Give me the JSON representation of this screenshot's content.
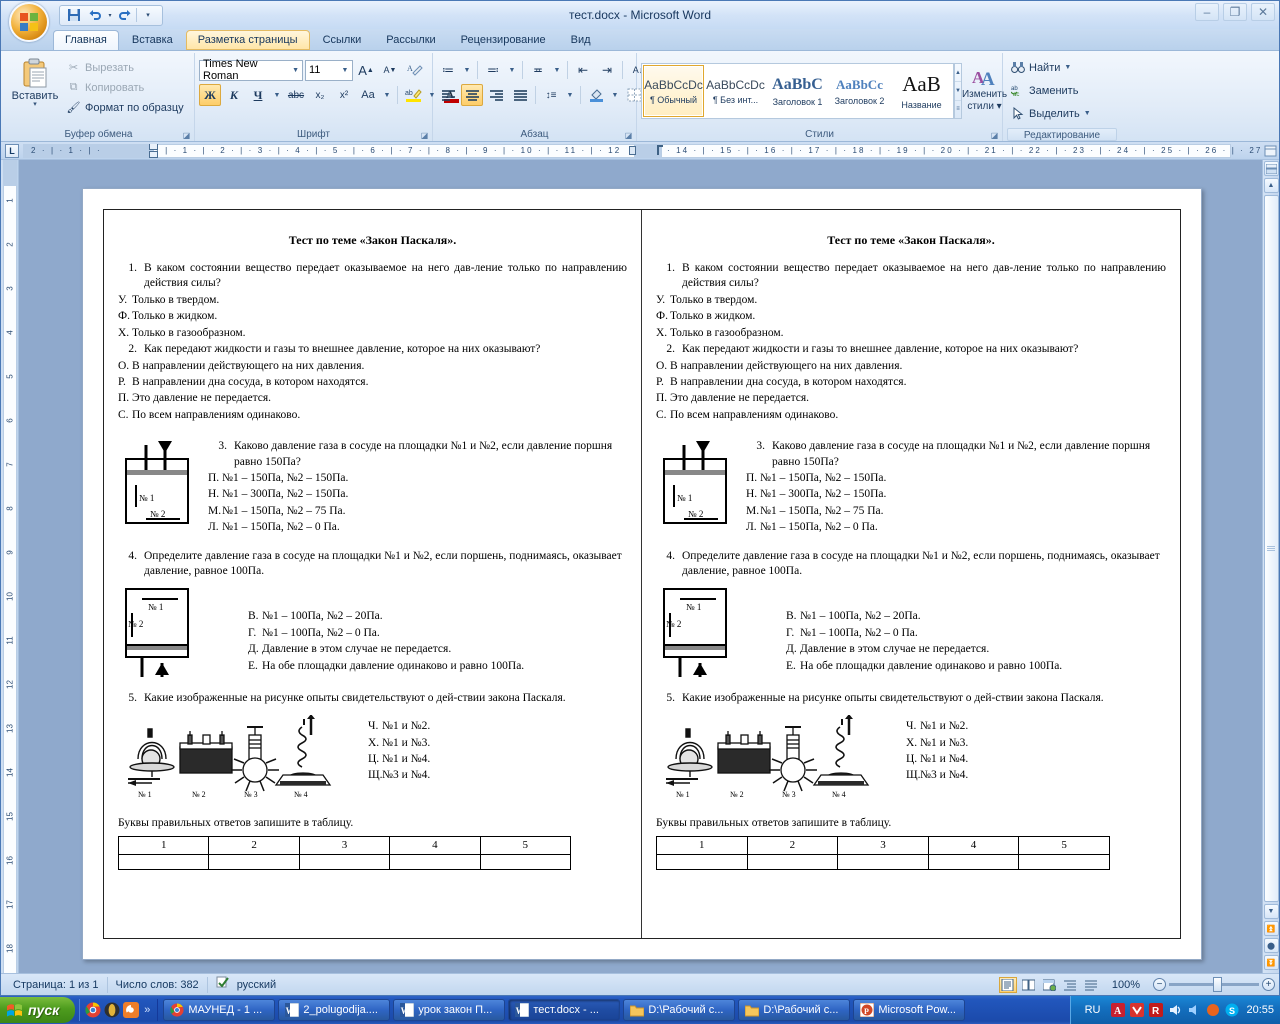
{
  "window": {
    "title": "тест.docx - Microsoft Word",
    "minimize": "–",
    "maximize": "❐",
    "close": "✕"
  },
  "quick_access": {
    "save": "💾",
    "undo": "↰",
    "redo": "↻",
    "customize": "▾"
  },
  "ribbon": {
    "tabs": [
      {
        "label": "Главная",
        "state": "active"
      },
      {
        "label": "Вставка",
        "state": "normal"
      },
      {
        "label": "Разметка страницы",
        "state": "hover"
      },
      {
        "label": "Ссылки",
        "state": "normal"
      },
      {
        "label": "Рассылки",
        "state": "normal"
      },
      {
        "label": "Рецензирование",
        "state": "normal"
      },
      {
        "label": "Вид",
        "state": "normal"
      }
    ],
    "clipboard": {
      "group_label": "Буфер обмена",
      "paste": "Вставить",
      "paste_arrow": "▾",
      "cut": "Вырезать",
      "copy": "Копировать",
      "format_painter": "Формат по образцу"
    },
    "font": {
      "group_label": "Шрифт",
      "font_name": "Times New Roman",
      "font_size": "11",
      "grow": "A",
      "shrink": "A",
      "clear_format": "A⃫",
      "bold": "Ж",
      "italic": "К",
      "underline": "Ч",
      "strike": "abc",
      "subscript": "x₂",
      "superscript": "x²",
      "change_case": "Aa",
      "highlight": "ab",
      "font_color": "A"
    },
    "paragraph": {
      "group_label": "Абзац",
      "bullets": "≔",
      "numbering": "≕",
      "multilevel": "≖",
      "decrease_indent": "⇤",
      "increase_indent": "⇥",
      "sort": "A↓",
      "show_marks": "¶",
      "align_left": "≡",
      "align_center": "≡",
      "align_right": "≡",
      "justify": "≡",
      "line_spacing": "↕≡",
      "shading": "◇",
      "borders": "⊞"
    },
    "styles": {
      "group_label": "Стили",
      "items": [
        {
          "preview": "AaBbCcDc",
          "name": "¶ Обычный",
          "selected": true
        },
        {
          "preview": "AaBbCcDc",
          "name": "¶ Без инт...",
          "selected": false
        },
        {
          "preview": "AaBbC",
          "name": "Заголовок 1",
          "selected": false
        },
        {
          "preview": "AaBbCc",
          "name": "Заголовок 2",
          "selected": false
        },
        {
          "preview": "AaB",
          "name": "Название",
          "selected": false
        }
      ],
      "change_styles": "Изменить",
      "change_styles2": "стили ▾"
    },
    "editing": {
      "group_label": "Редактирование",
      "find": "Найти",
      "replace": "Заменить",
      "select": "Выделить"
    }
  },
  "ruler": {
    "tab_selector": "L",
    "horizontal_ticks_left": "2 · | · 1 · | · ",
    "horizontal_ticks_mid": "· | · 1 · | · 2 · | · 3 · | · 4 · | · 5 · | · 6 · | · 7 · | · 8 · | · 9 · | · 10 · | · 11 · | · 12",
    "horizontal_ticks_right": "· 14 · | · 15 · | · 16 · | · 17 · | · 18 · | · 19 · | · 20 · | · 21 · | · 22 · | · 23 · | · 24 · | · 25 · | · 26 · | · 27 · |",
    "vertical_numbers": [
      "1",
      "2",
      "3",
      "4",
      "5",
      "6",
      "7",
      "8",
      "9",
      "10",
      "11",
      "12",
      "13",
      "14",
      "15",
      "16",
      "17",
      "18"
    ]
  },
  "document": {
    "title": "Тест по теме «Закон Паскаля».",
    "questions": [
      {
        "num": "1.",
        "text": "В каком состоянии вещество передает оказываемое на него дав-ление только по направлению действия силы?",
        "options": [
          {
            "letter": "У.",
            "text": "Только в твердом."
          },
          {
            "letter": "Ф.",
            "text": "Только в жидком."
          },
          {
            "letter": "Х.",
            "text": "Только в газообразном."
          }
        ]
      },
      {
        "num": "2.",
        "text": "Как передают жидкости и газы то внешнее давление, которое на них оказывают?",
        "options": [
          {
            "letter": "О.",
            "text": "В направлении действующего на них давления."
          },
          {
            "letter": "Р.",
            "text": "В направлении дна сосуда, в котором находятся."
          },
          {
            "letter": "П.",
            "text": "Это давление не передается."
          },
          {
            "letter": "С.",
            "text": "По всем направлениям одинаково."
          }
        ]
      },
      {
        "num": "3.",
        "text": "Каково давление газа в сосуде на площадки №1 и №2, если давление поршня равно 150Па?",
        "figure": "vessel-piston-down",
        "options": [
          {
            "letter": "П.",
            "text": "№1 – 150Па, №2 – 150Па."
          },
          {
            "letter": "Н.",
            "text": "№1 – 300Па, №2 – 150Па."
          },
          {
            "letter": "М.",
            "text": "№1 – 150Па, №2 – 75 Па."
          },
          {
            "letter": "Л.",
            "text": "№1 – 150Па, №2 – 0 Па."
          }
        ]
      },
      {
        "num": "4.",
        "text": "Определите давление газа в сосуде на площадки №1 и №2, если поршень, поднимаясь, оказывает давление, равное 100Па.",
        "figure": "vessel-piston-up",
        "options": [
          {
            "letter": "В.",
            "text": "№1 – 100Па, №2 – 20Па."
          },
          {
            "letter": "Г.",
            "text": "№1 – 100Па, №2 – 0 Па."
          },
          {
            "letter": "Д.",
            "text": "Давление в этом случае не передается."
          },
          {
            "letter": "Е.",
            "text": "На обе площадки давление одинаково и равно 100Па."
          }
        ]
      },
      {
        "num": "5.",
        "text": "Какие изображенные на рисунке опыты свидетельствуют о дей-ствии закона Паскаля.",
        "figure": "four-experiments",
        "figure_labels": [
          "№ 1",
          "№ 2",
          "№ 3",
          "№ 4"
        ],
        "options": [
          {
            "letter": "Ч.",
            "text": "№1 и №2."
          },
          {
            "letter": "Х.",
            "text": "№1 и №3."
          },
          {
            "letter": "Ц.",
            "text": "№1 и №4."
          },
          {
            "letter": "Щ.",
            "text": "№3 и №4."
          }
        ]
      }
    ],
    "vessel3_labels": [
      "№ 1",
      "№ 2"
    ],
    "vessel4_labels": [
      "№ 1",
      "№ 2"
    ],
    "table_caption": "Буквы правильных ответов запишите в таблицу.",
    "table_headers": [
      "1",
      "2",
      "3",
      "4",
      "5"
    ],
    "table_row": [
      "",
      "",
      "",
      "",
      ""
    ]
  },
  "statusbar": {
    "page": "Страница: 1 из 1",
    "words": "Число слов: 382",
    "proof_icon": "✓",
    "language": "русский",
    "views": [
      "print-layout",
      "full-screen",
      "web-layout",
      "outline",
      "draft"
    ],
    "zoom": "100%",
    "zoom_out": "−",
    "zoom_in": "+"
  },
  "taskbar": {
    "start": "пуск",
    "quick_more": "»",
    "quick_icons": [
      "chrome-icon",
      "opera-icon",
      "browser-icon"
    ],
    "tasks": [
      {
        "label": "МАУНЕД - 1 ...",
        "icon": "chrome-icon",
        "active": false
      },
      {
        "label": "2_polugodija....",
        "icon": "word-icon",
        "active": false
      },
      {
        "label": "урок закон П...",
        "icon": "word-icon",
        "active": false
      },
      {
        "label": "тест.docx - ...",
        "icon": "word-icon",
        "active": true
      },
      {
        "label": "D:\\Рабочий с...",
        "icon": "folder-icon",
        "active": false
      },
      {
        "label": "D:\\Рабочий с...",
        "icon": "folder-icon",
        "active": false
      },
      {
        "label": "Microsoft Pow...",
        "icon": "powerpoint-icon",
        "active": false
      }
    ],
    "language": "RU",
    "clock": "20:55"
  },
  "colors": {
    "accent": "#fdcd69",
    "titlebar": "#d3e3f7",
    "taskbar": "#2257bd",
    "start_green": "#4e9c1e"
  }
}
